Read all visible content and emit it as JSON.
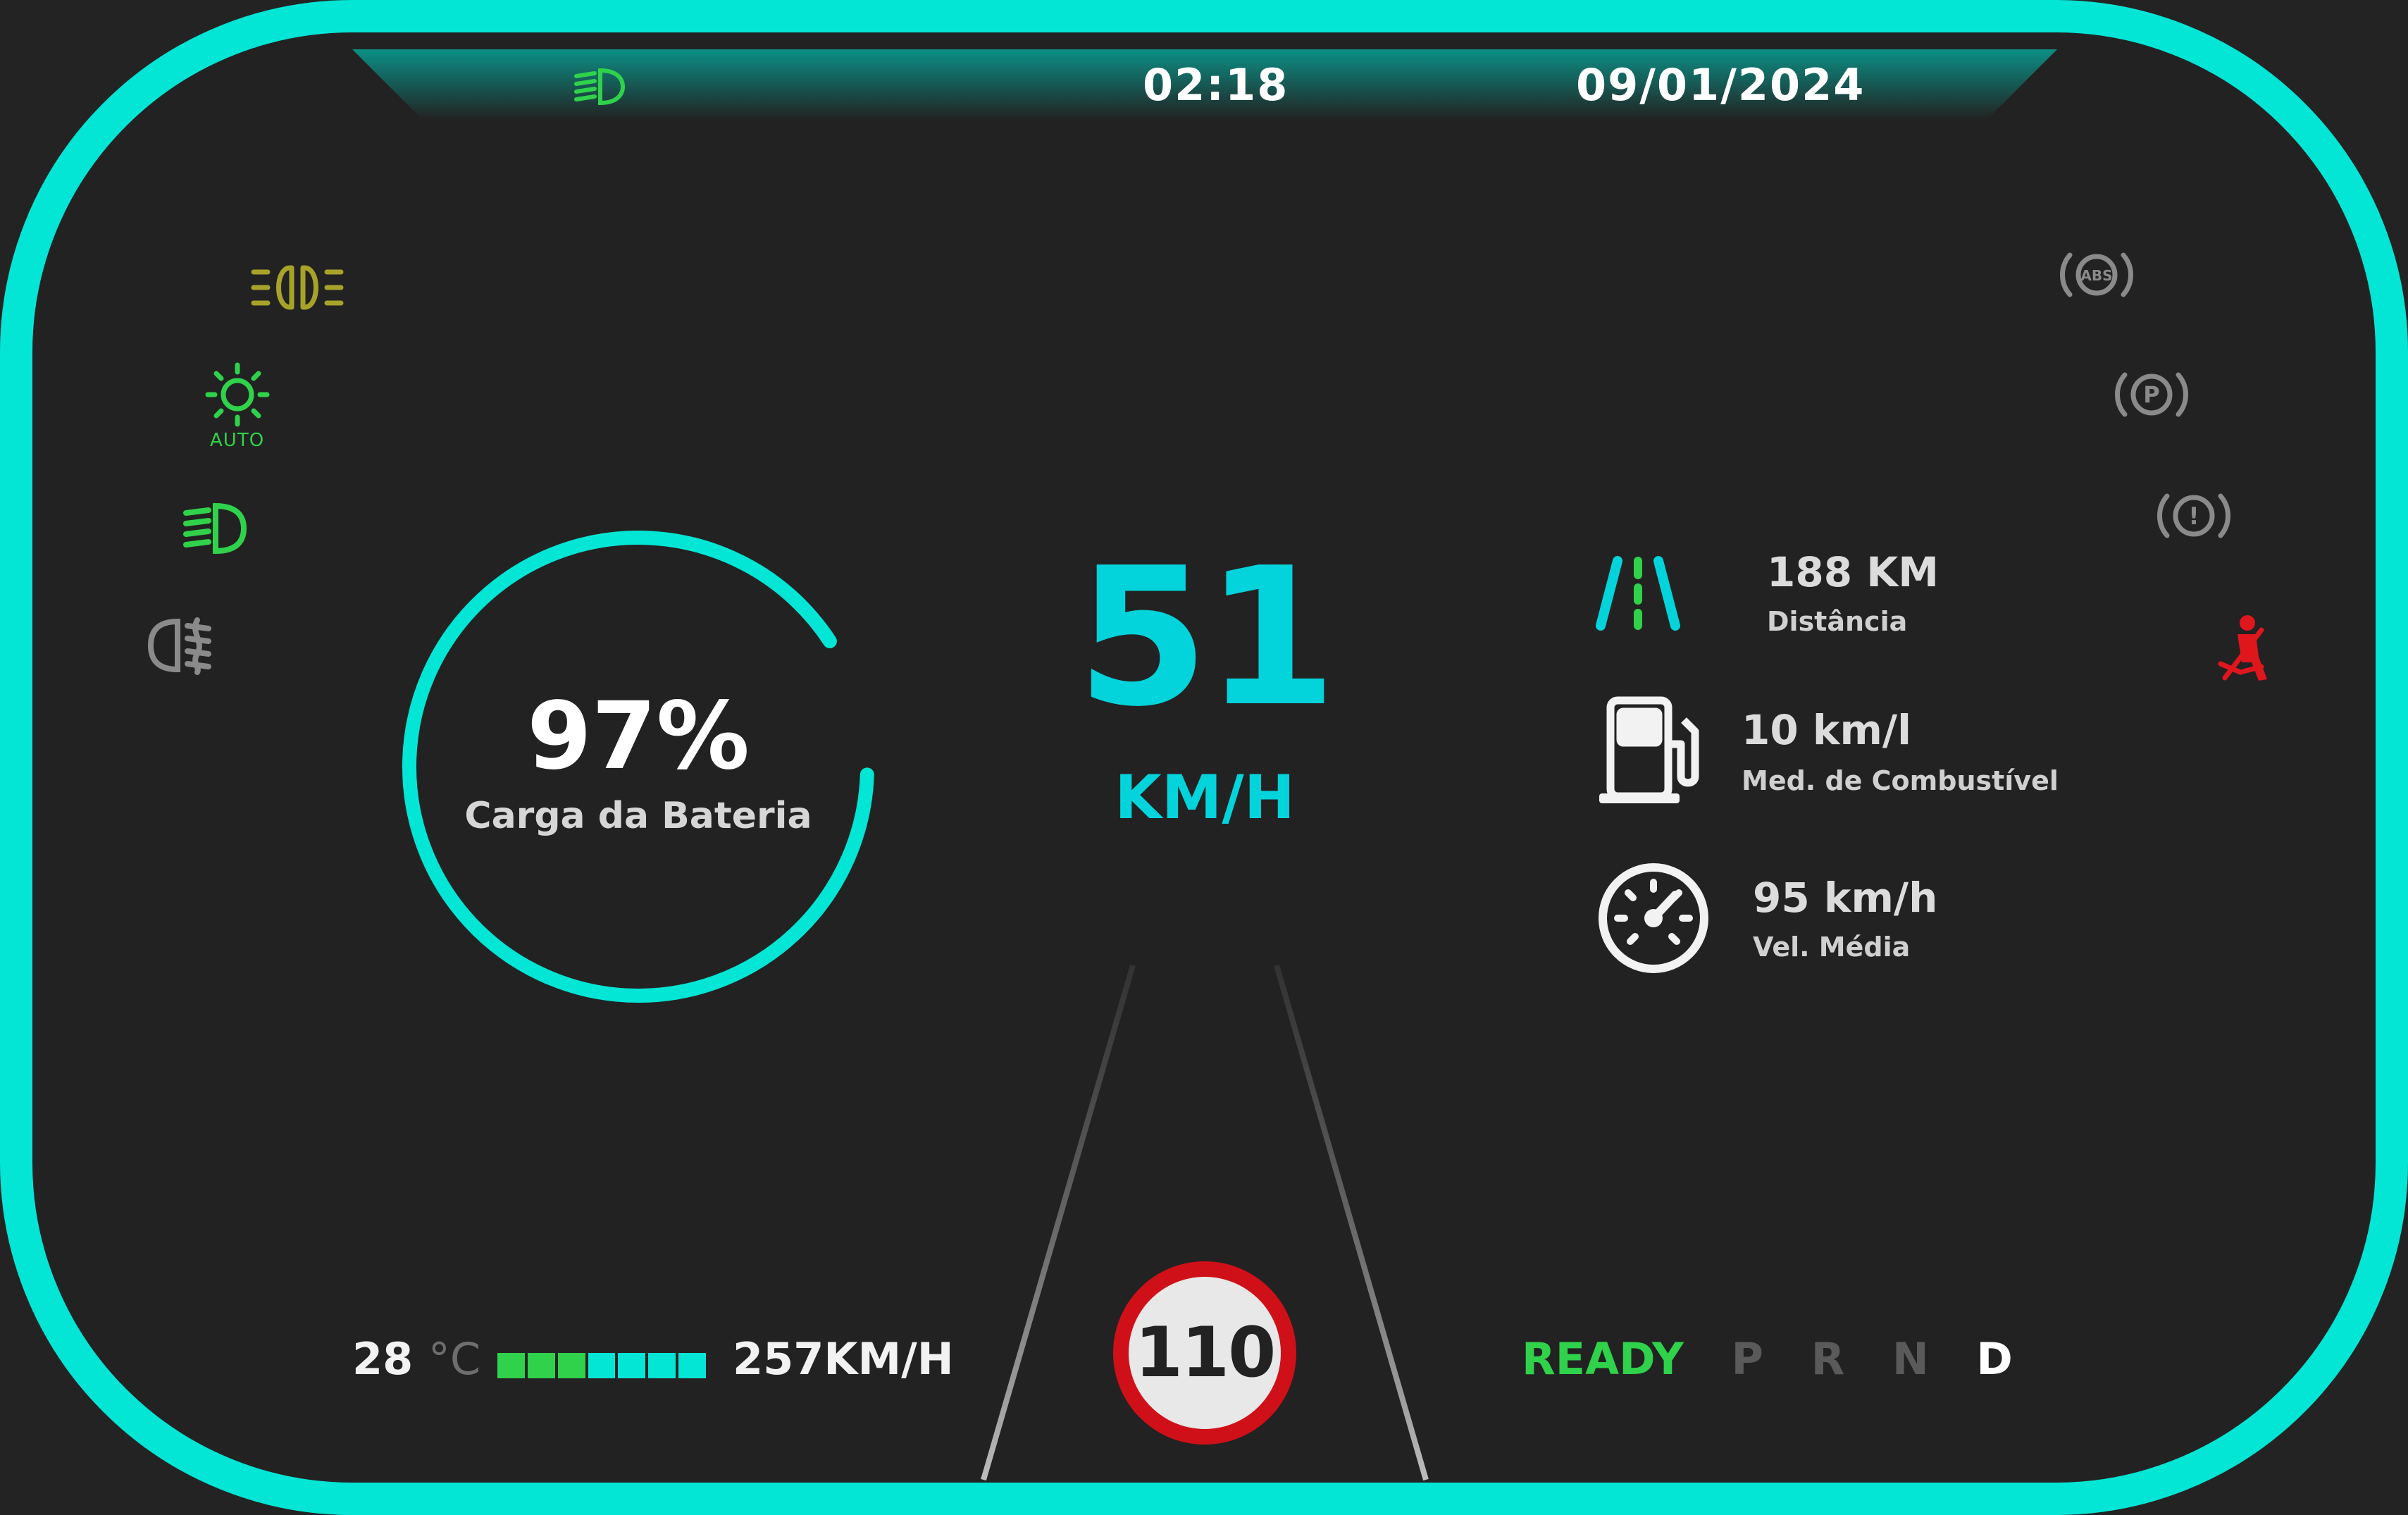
{
  "colors": {
    "accent": "#03e6d6",
    "background": "#222222",
    "indicator_green": "#2fd24a",
    "indicator_olive": "#a7a32a",
    "warning_red": "#e0161d",
    "inactive_gray": "#8a8a8a"
  },
  "topbar": {
    "indicator_icon": "headlight-icon",
    "time": "02:18",
    "date": "09/01/2024"
  },
  "left_indicators": [
    {
      "icon": "parking-lights-icon",
      "color": "#a7a32a"
    },
    {
      "icon": "auto-light-icon",
      "label": "AUTO",
      "color": "#2fd24a"
    },
    {
      "icon": "low-beam-icon",
      "color": "#2fd24a"
    },
    {
      "icon": "rear-fog-light-icon",
      "color": "#8a8a8a"
    }
  ],
  "right_indicators": [
    {
      "icon": "abs-warning-icon",
      "label": "ABS",
      "color": "#8a8a8a"
    },
    {
      "icon": "parking-brake-icon",
      "label": "P",
      "color": "#8a8a8a"
    },
    {
      "icon": "brake-warning-icon",
      "label": "!",
      "color": "#8a8a8a"
    },
    {
      "icon": "seatbelt-warning-icon",
      "color": "#e0161d"
    }
  ],
  "battery": {
    "percent_value": 97,
    "percent_text": "97%",
    "label": "Carga da Bateria"
  },
  "speed": {
    "value": "51",
    "unit": "KM/H"
  },
  "stats": [
    {
      "icon": "road-icon",
      "value": "188 KM",
      "label": "Distância"
    },
    {
      "icon": "fuel-pump-icon",
      "value": "10 km/l",
      "label": "Med. de Combustível"
    },
    {
      "icon": "speedometer-icon",
      "value": "95 km/h",
      "label": "Vel. Média"
    }
  ],
  "bottom_left": {
    "temperature": "28",
    "temperature_unit": "°C",
    "bar_segments": [
      "#2fd24a",
      "#2fd24a",
      "#2fd24a",
      "#03e6d6",
      "#03e6d6",
      "#03e6d6",
      "#03e6d6"
    ],
    "range_text": "257KM/H"
  },
  "speed_limit": "110",
  "gear": {
    "status": "READY",
    "options": [
      "P",
      "R",
      "N",
      "D"
    ],
    "selected": "D"
  }
}
